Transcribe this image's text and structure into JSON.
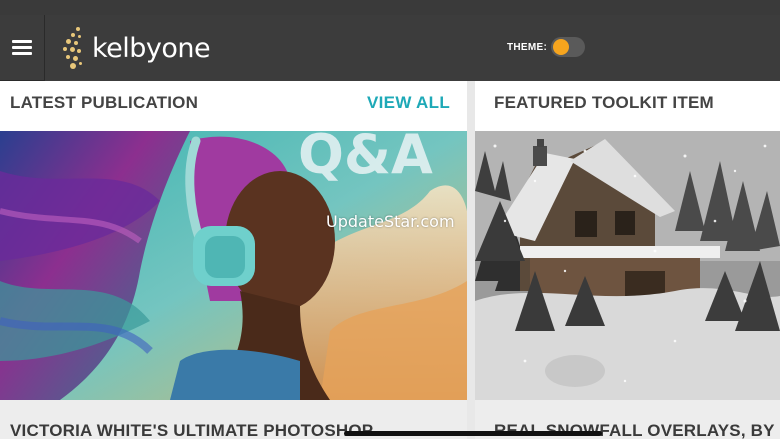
{
  "header": {
    "logo_text": "kelbyone",
    "theme_label": "THEME:",
    "colors": {
      "header_bg": "#3c3c3c",
      "accent": "#1ea9b7",
      "toggle_knob": "#f7a51e"
    }
  },
  "latest": {
    "title": "LATEST PUBLICATION",
    "view_all": "VIEW ALL",
    "image_text": "Q&A",
    "caption": "VICTORIA WHITE'S ULTIMATE PHOTOSHOP"
  },
  "featured": {
    "title": "FEATURED TOOLKIT ITEM",
    "caption": "REAL SNOWFALL OVERLAYS, BY"
  },
  "watermark": "UpdateStar.com"
}
